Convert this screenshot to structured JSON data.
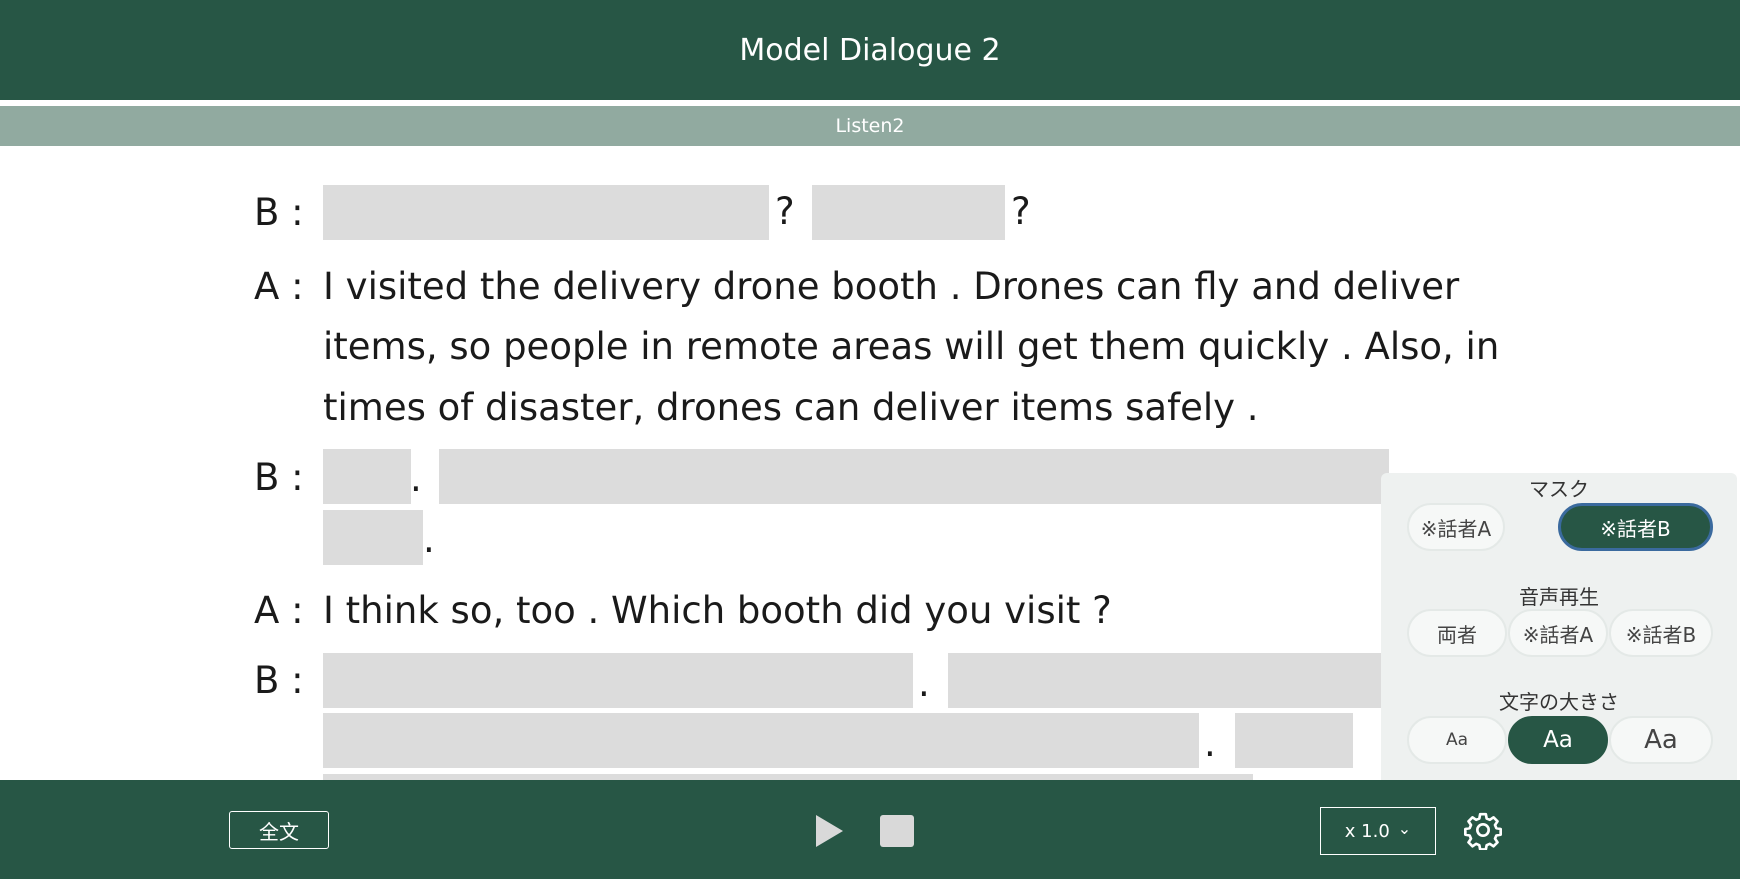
{
  "header": {
    "title": "Model Dialogue 2"
  },
  "subheader": {
    "label": "Listen2"
  },
  "dialogue": {
    "speaker_b": "B :",
    "speaker_a": "A :",
    "a1_line1": "I visited the delivery drone booth .  Drones can fly and deliver",
    "a1_line2": "items, so people in remote areas will get them quickly .  Also, in",
    "a1_line3": "times of disaster, drones can deliver items safely .",
    "a2_line1": "I think so, too .  Which booth did you visit ?",
    "q_mark": "?",
    "period": "."
  },
  "settings": {
    "mask_title": "マスク",
    "mask_options": [
      "※話者A",
      "※話者B"
    ],
    "mask_selected": "※話者B",
    "audio_title": "音声再生",
    "audio_options": [
      "両者",
      "※話者A",
      "※話者B"
    ],
    "size_title": "文字の大きさ",
    "size_options": [
      "Aa",
      "Aa",
      "Aa"
    ],
    "size_selected_index": 1
  },
  "footer": {
    "fulltext_label": "全文",
    "speed_label": "x 1.0",
    "speed_chevron": "⌄"
  },
  "colors": {
    "brand_green": "#275645",
    "sub_green": "#91aaa0",
    "mask_gray": "#dcdcdc",
    "active_border": "#3a6a9e"
  }
}
